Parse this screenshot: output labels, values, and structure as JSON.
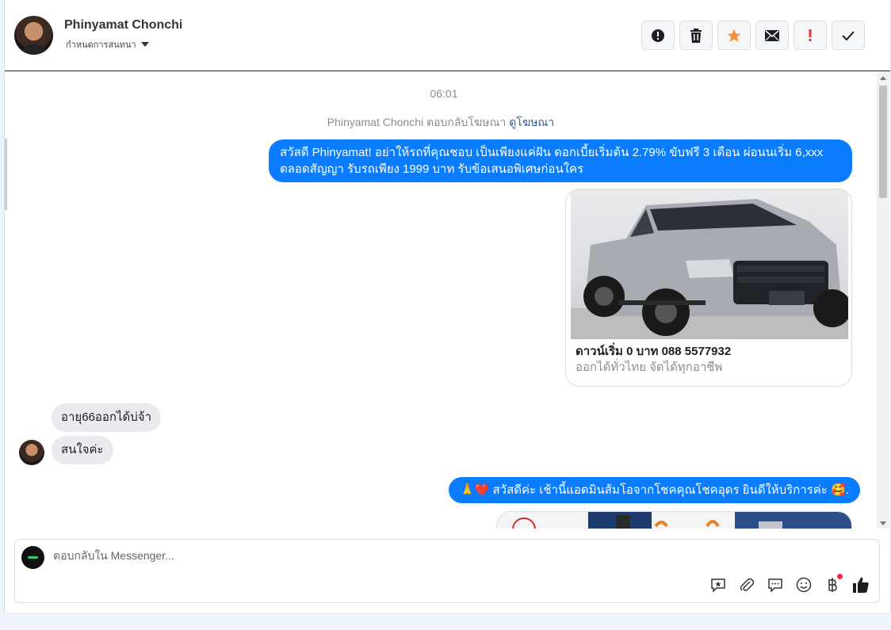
{
  "header": {
    "name": "Phinyamat Chonchi",
    "subtitle": "กำหนดการสนทนา",
    "actions": [
      {
        "name": "info-icon",
        "glyph": "!"
      },
      {
        "name": "trash-icon",
        "glyph": ""
      },
      {
        "name": "star-icon",
        "glyph": ""
      },
      {
        "name": "mail-icon",
        "glyph": ""
      },
      {
        "name": "alert-icon",
        "glyph": "!"
      },
      {
        "name": "check-icon",
        "glyph": ""
      }
    ]
  },
  "chat": {
    "time": "06:01",
    "ad_prefix": "Phinyamat Chonchi ตอบกลับโฆษณา",
    "ad_link": "ดูโฆษณา",
    "msg1": "สวัสดี Phinyamat! อย่าให้รถที่คุณชอบ เป็นเพียงแค่ฝัน ดอกเบี้ยเริ่มต้น 2.79% ขับฟรี 3 เดือน ผ่อนนเริ่ม 6,xxx ตลอดสัญญา รับรถเพียง 1999 บาท รับข้อเสนอพิเศษก่อนใคร",
    "card_title": "ดาวน์เริ่ม 0 บาท 088 5577932",
    "card_sub": "ออกได้ทั่วไทย จัดได้ทุกอาชีพ",
    "in1": "อายุ66ออกได้บ่จ้า",
    "in2": "สนใจค่ะ",
    "msg2": "🙏❤️ สวัสดีค่ะ เช้านี้แอดมินส้มโอจากโชคคุณโชคอุดร ยินดีให้บริการค่ะ 🥰."
  },
  "composer": {
    "placeholder": "ตอบกลับใน Messenger..."
  },
  "colors": {
    "accent": "#0a7cff",
    "star": "#f7923b",
    "alert": "#e03b2c"
  }
}
